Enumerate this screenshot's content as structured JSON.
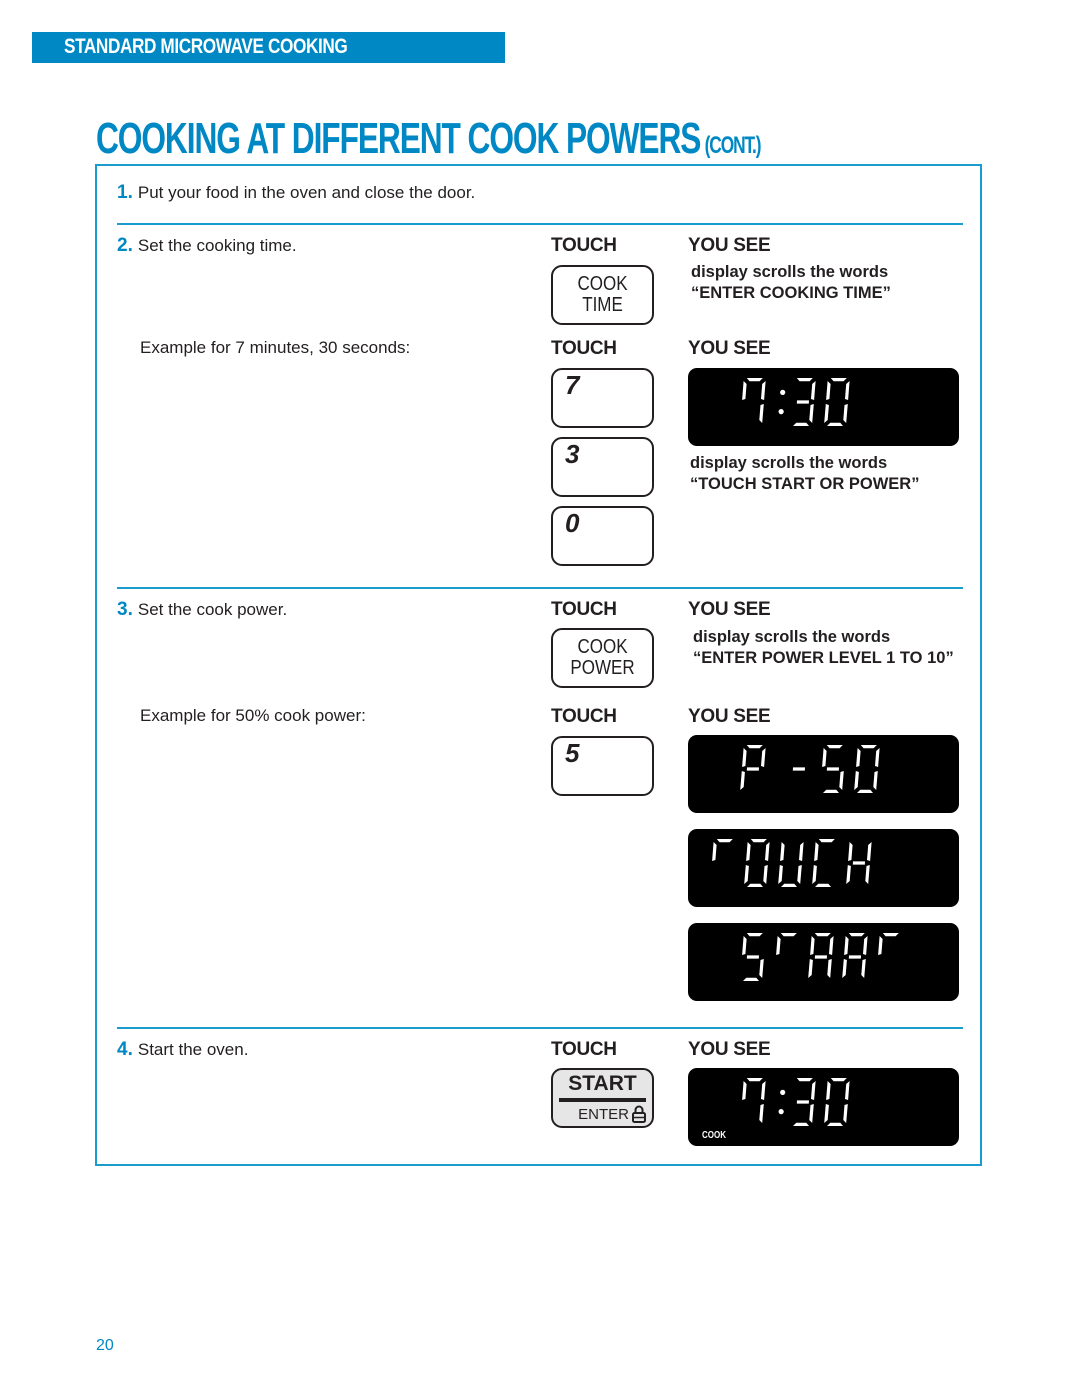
{
  "header": {
    "section_label": "STANDARD MICROWAVE COOKING",
    "title_main": "COOKING AT DIFFERENT COOK POWERS",
    "title_suffix": "(CONT.)"
  },
  "colors": {
    "accent": "#0088c4",
    "frame": "#1a9ccc",
    "text": "#231f20",
    "lcd_bg": "#000000",
    "lcd_fg": "#ffffff"
  },
  "steps": [
    {
      "num": "1.",
      "text": "Put your food in the oven and close the door."
    },
    {
      "num": "2.",
      "text": "Set the cooking time.",
      "example": "Example for 7 minutes, 30 seconds:"
    },
    {
      "num": "3.",
      "text": "Set the cook power.",
      "example": "Example for 50% cook power:"
    },
    {
      "num": "4.",
      "text": "Start the oven."
    }
  ],
  "columns": {
    "touch": "TOUCH",
    "you_see": "YOU SEE"
  },
  "keys": {
    "cook_time": [
      "COOK",
      "TIME"
    ],
    "cook_power": [
      "COOK",
      "POWER"
    ],
    "digits": {
      "seven": "7",
      "three": "3",
      "zero": "0",
      "five": "5"
    },
    "start": {
      "top": "START",
      "bottom": "ENTER",
      "icon": "lock-icon"
    }
  },
  "descriptions": {
    "enter_cooking_time": [
      "display scrolls the words",
      "“ENTER COOKING TIME”"
    ],
    "touch_start_or_power": [
      "display scrolls the words",
      "“TOUCH START OR POWER”"
    ],
    "enter_power_level": [
      "display scrolls the words",
      "“ENTER POWER LEVEL 1 TO 10”"
    ]
  },
  "displays": {
    "time_730": "7:30",
    "power_p50": "P -50",
    "touch": "TOUCH",
    "start": "START",
    "cooking_730": "7:30",
    "cooking_indicator": "COOK"
  },
  "footer": {
    "page_number": "20"
  }
}
